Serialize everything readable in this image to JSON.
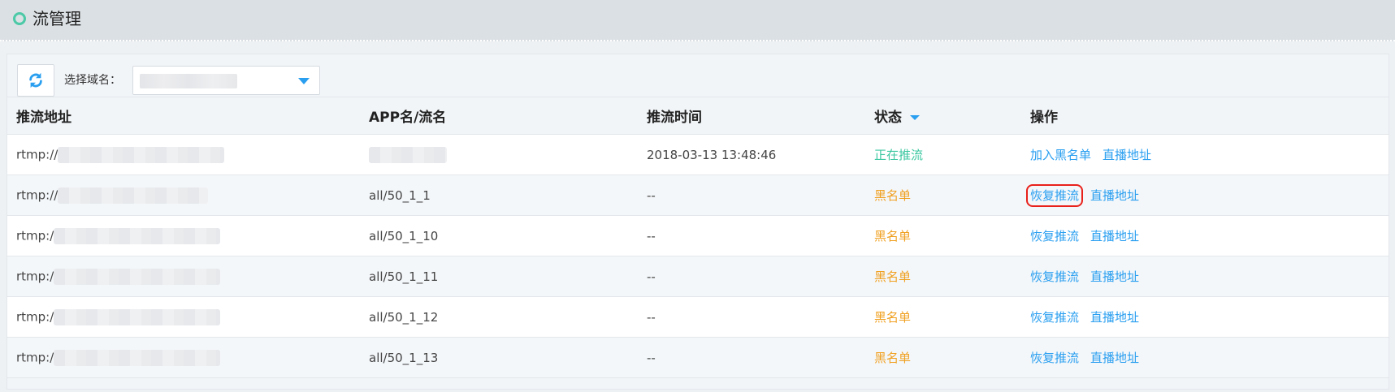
{
  "header": {
    "title": "流管理"
  },
  "toolbar": {
    "domain_label": "选择域名：",
    "domain_value": ""
  },
  "colors": {
    "accent": "#2a9ff0",
    "live": "#3cc7a0",
    "blacklisted": "#f0a020",
    "highlight": "#e8211b"
  },
  "table": {
    "columns": [
      "推流地址",
      "APP名/流名",
      "推流时间",
      "状态",
      "操作"
    ],
    "rows": [
      {
        "push_url": "rtmp://",
        "app_stream": "",
        "push_time": "2018-03-13 13:48:46",
        "status": "正在推流",
        "status_type": "live",
        "action_primary": "加入黑名单",
        "action_secondary": "直播地址"
      },
      {
        "push_url": "rtmp://",
        "app_stream": "all/50_1_1",
        "push_time": "--",
        "status": "黑名单",
        "status_type": "black",
        "action_primary": "恢复推流",
        "action_secondary": "直播地址"
      },
      {
        "push_url": "rtmp:/",
        "app_stream": "all/50_1_10",
        "push_time": "--",
        "status": "黑名单",
        "status_type": "black",
        "action_primary": "恢复推流",
        "action_secondary": "直播地址"
      },
      {
        "push_url": "rtmp:/",
        "app_stream": "all/50_1_11",
        "push_time": "--",
        "status": "黑名单",
        "status_type": "black",
        "action_primary": "恢复推流",
        "action_secondary": "直播地址"
      },
      {
        "push_url": "rtmp:/",
        "app_stream": "all/50_1_12",
        "push_time": "--",
        "status": "黑名单",
        "status_type": "black",
        "action_primary": "恢复推流",
        "action_secondary": "直播地址"
      },
      {
        "push_url": "rtmp:/",
        "app_stream": "all/50_1_13",
        "push_time": "--",
        "status": "黑名单",
        "status_type": "black",
        "action_primary": "恢复推流",
        "action_secondary": "直播地址"
      }
    ]
  }
}
